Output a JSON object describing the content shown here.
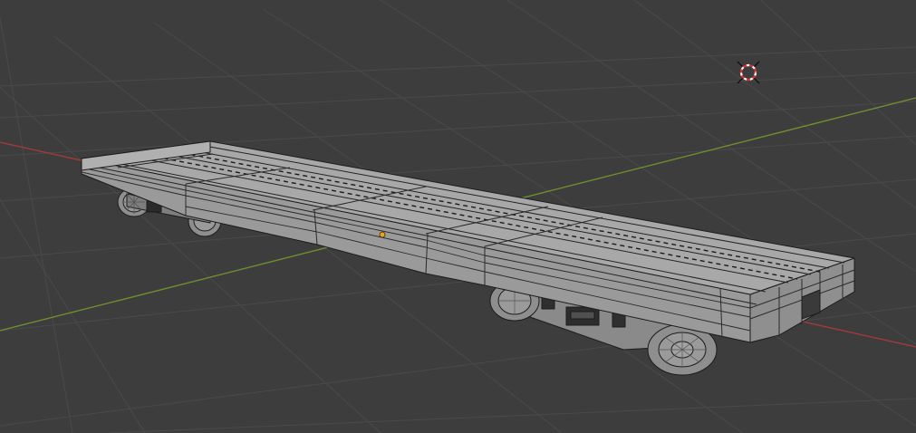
{
  "viewport": {
    "background_color": "#3d3d3d",
    "grid_color": "#4a4a4a",
    "x_axis_color": "#a23a3a",
    "y_axis_color": "#6f8f2e"
  },
  "scene": {
    "object": "flatcar-mesh",
    "mesh_face_color": "#9d9d9d",
    "mesh_top_color": "#a8a8a8",
    "mesh_edge_color": "#1c1c1c",
    "origin_color": "#f0a020"
  },
  "icons": {
    "cursor": "3d-cursor-icon",
    "origin": "object-origin-icon"
  }
}
